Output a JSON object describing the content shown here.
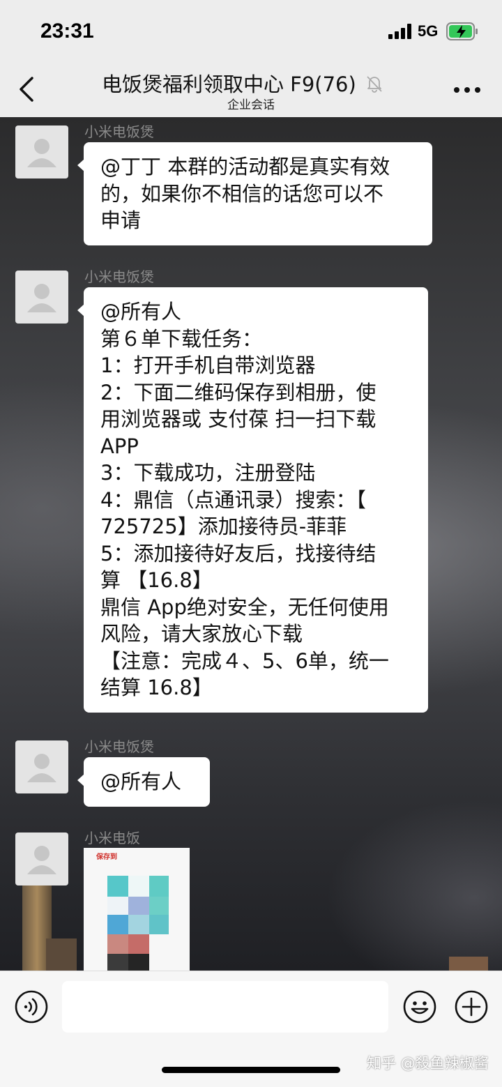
{
  "status": {
    "time": "23:31",
    "network": "5G"
  },
  "header": {
    "title": "电饭煲福利领取中心 F9(76)",
    "subtitle": "企业会话"
  },
  "messages": [
    {
      "sender": "小米电饭煲",
      "lines": [
        "@丁丁 本群的活动都是真实有效",
        "的，如果你不相信的话您可以不",
        "申请"
      ]
    },
    {
      "sender": "小米电饭煲",
      "lines": [
        "@所有人",
        "第６单下载任务：",
        "1：打开手机自带浏览器",
        "2：下面二维码保存到相册，使",
        "用浏览器或 支付葆 扫一扫下载",
        "APP",
        "3：下载成功，注册登陆",
        "4：鼎信（点通讯录）搜索：【",
        "725725】添加接待员-菲菲",
        "5：添加接待好友后，找接待结",
        "算 【16.8】",
        "鼎信 App绝对安全，无任何使用",
        "风险，请大家放心下载",
        "【注意：完成４、5、6单，统一",
        "结算 16.8】"
      ]
    },
    {
      "sender": "小米电饭煲",
      "lines": [
        "@所有人"
      ]
    },
    {
      "sender": "小米电饭",
      "image_caption": "保存到"
    }
  ],
  "watermark": "知乎 @殺鱼辣椒酱",
  "icons": {
    "back": "chevron-left-icon",
    "mute": "bell-off-icon",
    "more": "ellipsis-icon",
    "voice": "voice-icon",
    "emoji": "emoji-icon",
    "plus": "plus-icon"
  },
  "colors": {
    "bar_bg": "#ededed",
    "bubble_bg": "#ffffff",
    "sender_text": "#8a8a8a",
    "battery_green": "#34c759"
  }
}
